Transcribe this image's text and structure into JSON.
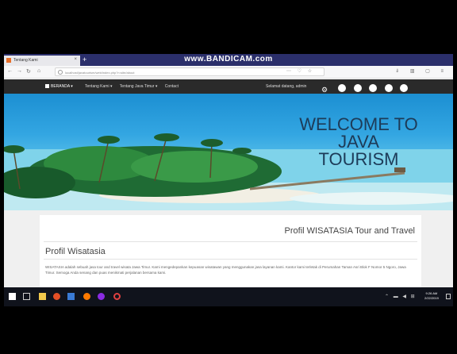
{
  "recorder_watermark": "www.BANDICAM.com",
  "browser": {
    "tab_title": "Tentang Kami",
    "tab_close": "×",
    "new_tab": "+",
    "nav_icons": [
      "back-icon",
      "forward-icon",
      "reload-icon",
      "home-icon"
    ],
    "url": "localhost/javatourism/web/index.php?r=site/about",
    "toolbar_glyphs": "⋯ ♡ ☆",
    "right_glyphs": "⇓ ▥ ▢ ≡"
  },
  "site": {
    "brand": "BERANDA ▾",
    "menu": [
      "Tentang Kami ▾",
      "Tentang Java Timur ▾",
      "Contact"
    ],
    "welcome_user": "Selamat datang, admin",
    "social_icons": [
      "gear-icon",
      "facebook-icon",
      "google-icon",
      "twitter-icon",
      "instagram-icon",
      "youtube-icon"
    ],
    "gear_glyph": "⚙"
  },
  "hero": {
    "title_line1": "WELCOME TO",
    "title_line2": "JAVA TOURISM"
  },
  "content": {
    "card_title": "Profil WISATASIA Tour and Travel",
    "section_title": "Profil Wisatasia",
    "paragraph": "WISATASIA adalah sebuah jasa tour and travel wisata Jawa Timur. Kami mengedepankan kepuasan wisatawan yang menggunakan jasa layanan kami. Kantor kami terletak di Perumahan Taman Asri Blok F Nomor 5 Ngoro, Jawa Timur. Semoga Anda senang dan puas menikmati perjalanan bersama kami."
  },
  "taskbar": {
    "apps": [
      "start-icon",
      "taskview-icon",
      "explorer-icon",
      "chrome-icon",
      "store-icon",
      "firefox-icon",
      "photoshop-icon",
      "media-icon"
    ],
    "tray": "⌃ ▬ ◀ ⊞",
    "time": "9:26 AM",
    "date": "2/22/2019"
  },
  "colors": {
    "title_bar": "#2b2f6b",
    "site_nav": "#2a2a2a",
    "taskbar": "#10131c",
    "hero_text": "#1d3b58"
  }
}
